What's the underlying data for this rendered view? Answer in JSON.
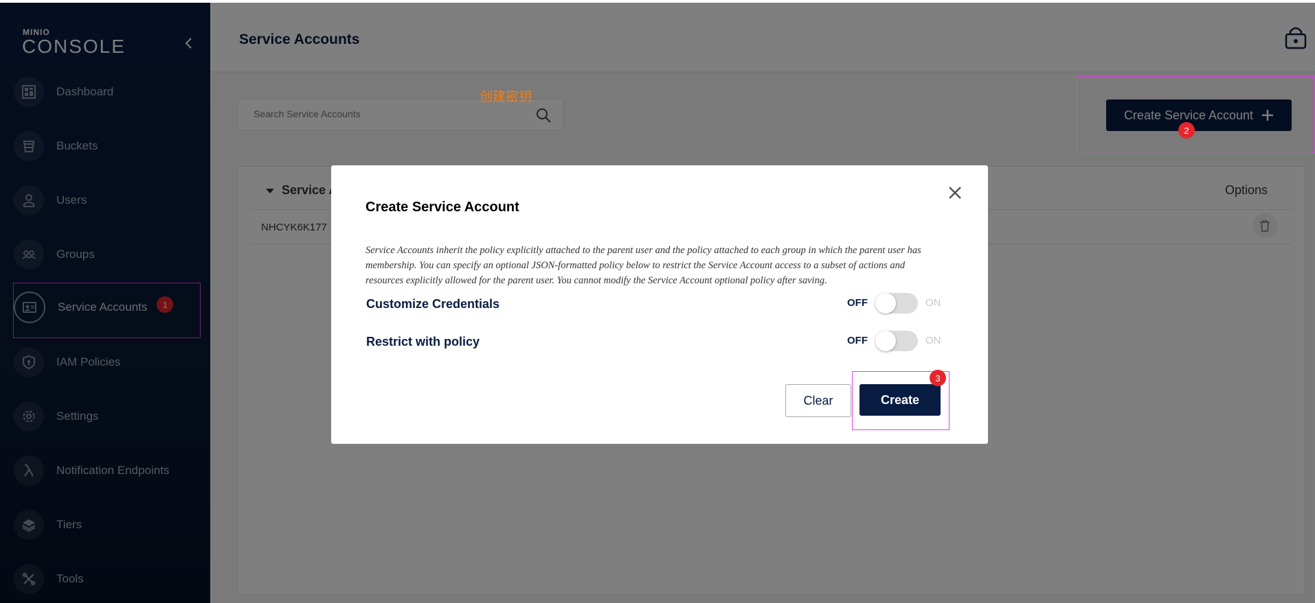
{
  "sidebar": {
    "logo_small": "MINIO",
    "logo_big": "CONSOLE",
    "items": [
      {
        "label": "Dashboard",
        "icon": "dashboard-icon"
      },
      {
        "label": "Buckets",
        "icon": "bucket-icon"
      },
      {
        "label": "Users",
        "icon": "user-icon"
      },
      {
        "label": "Groups",
        "icon": "groups-icon"
      },
      {
        "label": "Service Accounts",
        "icon": "id-card-icon",
        "active": true,
        "badge": "1"
      },
      {
        "label": "IAM Policies",
        "icon": "shield-icon"
      },
      {
        "label": "Settings",
        "icon": "gear-icon"
      },
      {
        "label": "Notification Endpoints",
        "icon": "lambda-icon"
      },
      {
        "label": "Tiers",
        "icon": "layers-icon"
      },
      {
        "label": "Tools",
        "icon": "tools-icon"
      }
    ]
  },
  "header": {
    "title": "Service Accounts"
  },
  "search": {
    "placeholder": "Search Service Accounts"
  },
  "annotation_text": "创建密钥",
  "create_button": {
    "label": "Create Service Account",
    "badge": "2"
  },
  "table": {
    "columns": [
      "Service A",
      "Options"
    ],
    "rows": [
      {
        "access_key": "NHCYK6K177"
      }
    ]
  },
  "modal": {
    "title": "Create Service Account",
    "description": "Service Accounts inherit the policy explicitly attached to the parent user and the policy attached to each group in which the parent user has membership. You can specify an optional JSON-formatted policy below to restrict the Service Account access to a subset of actions and resources explicitly allowed for the parent user. You cannot modify the Service Account optional policy after saving.",
    "toggles": [
      {
        "label": "Customize Credentials",
        "off": "OFF",
        "on": "ON",
        "value": false
      },
      {
        "label": "Restrict with policy",
        "off": "OFF",
        "on": "ON",
        "value": false
      }
    ],
    "clear_label": "Clear",
    "create_label": "Create",
    "create_badge": "3"
  },
  "colors": {
    "brand": "#081c42",
    "highlight": "#e040e8",
    "badge": "#e6262d",
    "annotation": "#f57f17"
  }
}
